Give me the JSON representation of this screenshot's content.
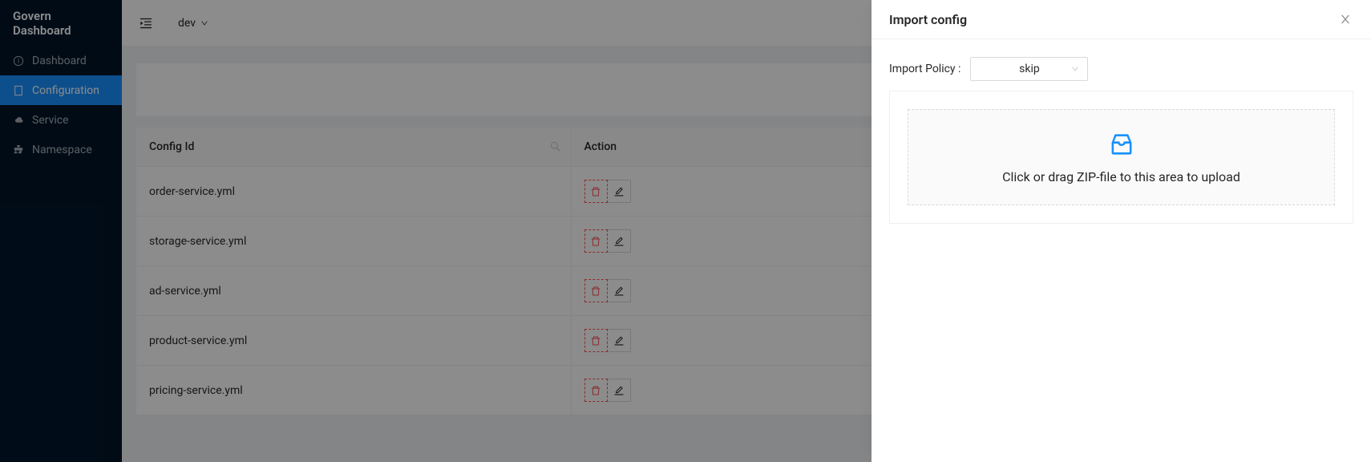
{
  "app": {
    "title": "Govern Dashboard"
  },
  "sidebar": {
    "items": [
      {
        "label": "Dashboard",
        "icon": "dashboard-icon"
      },
      {
        "label": "Configuration",
        "icon": "file-icon"
      },
      {
        "label": "Service",
        "icon": "cloud-icon"
      },
      {
        "label": "Namespace",
        "icon": "cluster-icon"
      }
    ]
  },
  "topbar": {
    "env": "dev"
  },
  "table": {
    "columns": {
      "configId": "Config Id",
      "action": "Action"
    },
    "rows": [
      {
        "configId": "order-service.yml"
      },
      {
        "configId": "storage-service.yml"
      },
      {
        "configId": "ad-service.yml"
      },
      {
        "configId": "product-service.yml"
      },
      {
        "configId": "pricing-service.yml"
      }
    ]
  },
  "drawer": {
    "title": "Import config",
    "importPolicyLabel": "Import Policy :",
    "importPolicyValue": "skip",
    "uploadText": "Click or drag ZIP-file to this area to upload"
  }
}
